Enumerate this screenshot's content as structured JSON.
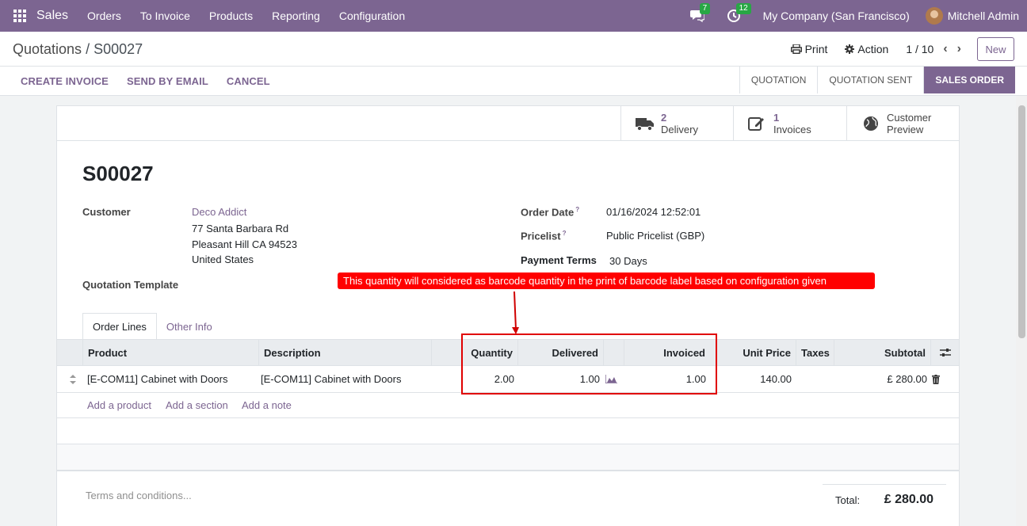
{
  "navbar": {
    "brand": "Sales",
    "menu": [
      "Orders",
      "To Invoice",
      "Products",
      "Reporting",
      "Configuration"
    ],
    "chat_count": "7",
    "activity_count": "12",
    "company": "My Company (San Francisco)",
    "user": "Mitchell Admin"
  },
  "control": {
    "breadcrumb_parent": "Quotations",
    "breadcrumb_sep": " / ",
    "breadcrumb_current": "S00027",
    "print_label": "Print",
    "action_label": "Action",
    "pager": "1 / 10",
    "new_label": "New"
  },
  "header": {
    "buttons": [
      "CREATE INVOICE",
      "SEND BY EMAIL",
      "CANCEL"
    ],
    "stages": [
      "QUOTATION",
      "QUOTATION SENT",
      "SALES ORDER"
    ],
    "active_stage": "SALES ORDER"
  },
  "smart_buttons": {
    "delivery": {
      "value": "2",
      "label": "Delivery"
    },
    "invoices": {
      "value": "1",
      "label": "Invoices"
    },
    "preview": {
      "line1": "Customer",
      "line2": "Preview"
    }
  },
  "form": {
    "name": "S00027",
    "customer_label": "Customer",
    "customer_name": "Deco Addict",
    "address1": "77 Santa Barbara Rd",
    "address2": "Pleasant Hill CA 94523",
    "address3": "United States",
    "template_label": "Quotation Template",
    "order_date_label": "Order Date",
    "order_date": "01/16/2024 12:52:01",
    "pricelist_label": "Pricelist",
    "pricelist": "Public Pricelist (GBP)",
    "payment_terms_label": "Payment Terms",
    "payment_terms": "30 Days",
    "help_mark": "?"
  },
  "tabs": [
    "Order Lines",
    "Other Info"
  ],
  "table": {
    "headers": {
      "product": "Product",
      "description": "Description",
      "quantity": "Quantity",
      "delivered": "Delivered",
      "invoiced": "Invoiced",
      "unit_price": "Unit Price",
      "taxes": "Taxes",
      "subtotal": "Subtotal"
    },
    "rows": [
      {
        "product": "[E-COM11] Cabinet with Doors",
        "description": "[E-COM11] Cabinet with Doors",
        "quantity": "2.00",
        "delivered": "1.00",
        "invoiced": "1.00",
        "unit_price": "140.00",
        "taxes": "",
        "subtotal": "£ 280.00"
      }
    ],
    "add_links": [
      "Add a product",
      "Add a section",
      "Add a note"
    ]
  },
  "footer": {
    "terms_placeholder": "Terms and conditions...",
    "total_label": "Total:",
    "total_value": "£ 280.00"
  },
  "annotation": {
    "text": "This quantity will considered as barcode quantity in the print of barcode label based on configuration given",
    "color": "#ff0000"
  },
  "colors": {
    "brand": "#7c6591",
    "annotation": "#ff0000"
  }
}
